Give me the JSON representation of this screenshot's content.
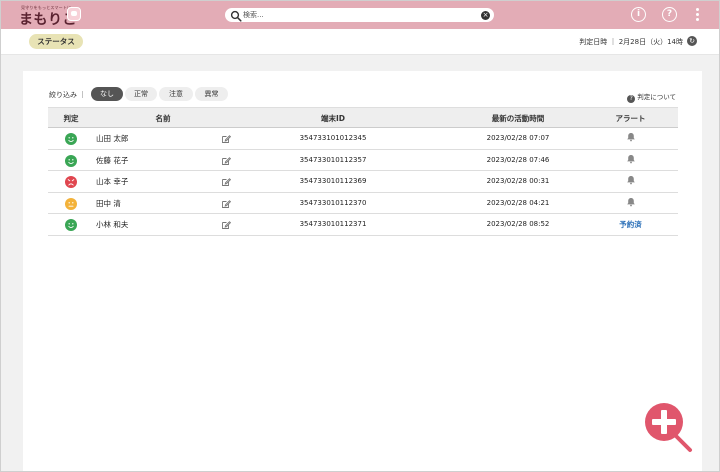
{
  "header": {
    "logo_tagline": "見守りをもっとスマートに",
    "logo_text": "まもりこ",
    "search_placeholder": "検索...",
    "info_label": "i",
    "help_label": "?"
  },
  "subbar": {
    "status_tab": "ステータス",
    "judge_time": "判定日時 ｜ 2月28日（火）14時"
  },
  "filter": {
    "label": "絞り込み ｜",
    "chips": [
      "なし",
      "正常",
      "注意",
      "異常"
    ],
    "active_index": 0,
    "about_link": "判定について"
  },
  "table": {
    "headers": {
      "judge": "判定",
      "name": "名前",
      "device_id": "端末ID",
      "last_activity": "最新の活動時間",
      "alert": "アラート"
    },
    "rows": [
      {
        "status": "normal",
        "name": "山田 太郎",
        "device_id": "354733101012345",
        "last_activity": "2023/02/28 07:07",
        "alert": "bell"
      },
      {
        "status": "normal",
        "name": "佐藤 花子",
        "device_id": "354733010112357",
        "last_activity": "2023/02/28 07:46",
        "alert": "bell"
      },
      {
        "status": "abnormal",
        "name": "山本 幸子",
        "device_id": "354733010112369",
        "last_activity": "2023/02/28 00:31",
        "alert": "bell"
      },
      {
        "status": "caution",
        "name": "田中 清",
        "device_id": "354733010112370",
        "last_activity": "2023/02/28 04:21",
        "alert": "bell"
      },
      {
        "status": "normal",
        "name": "小林 和夫",
        "device_id": "354733010112371",
        "last_activity": "2023/02/28 08:52",
        "alert": "予約済"
      }
    ]
  },
  "colors": {
    "header_bg": "#e3acb6",
    "normal": "#3aa655",
    "caution": "#f3b23a",
    "abnormal": "#e0464f",
    "reserved_link": "#2a6fb8",
    "zoom_fab": "#e0566c"
  },
  "icons": {
    "search": "search-icon",
    "clear": "clear-icon",
    "info": "info-icon",
    "help": "help-icon",
    "more": "more-vertical-icon",
    "refresh": "refresh-icon",
    "edit": "edit-icon",
    "bell": "bell-icon",
    "zoom": "zoom-in-icon"
  }
}
